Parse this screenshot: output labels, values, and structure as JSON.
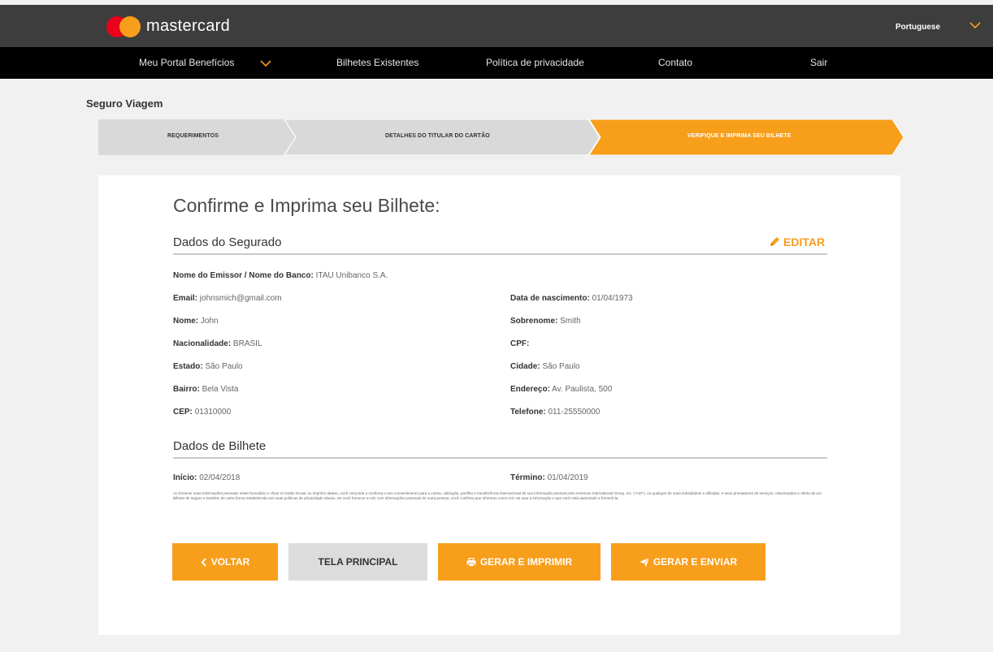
{
  "header": {
    "brand": "mastercard",
    "language": "Portuguese"
  },
  "nav": {
    "items": [
      {
        "label": "Meu Portal Benefícios"
      },
      {
        "label": "Bilhetes Existentes"
      },
      {
        "label": "Política de privacidade"
      },
      {
        "label": "Contato"
      },
      {
        "label": "Sair"
      }
    ]
  },
  "page": {
    "title": "Seguro Viagem"
  },
  "stepper": {
    "steps": [
      {
        "label": "REQUERIMENTOS",
        "active": false
      },
      {
        "label": "DETALHES DO TITULAR DO CARTÃO",
        "active": false
      },
      {
        "label": "VERIFIQUE E IMPRIMA SEU BILHETE",
        "active": true
      }
    ]
  },
  "main": {
    "title": "Confirme e Imprima seu Bilhete:",
    "insured_section": "Dados do Segurado",
    "edit_label": "EDITAR",
    "ticket_section": "Dados de Bilhete",
    "fields": {
      "issuer": {
        "label": "Nome do Emissor / Nome do Banco:",
        "value": "ITAU Unibanco S.A."
      },
      "email": {
        "label": "Email:",
        "value": "johnsmich@gmail.com"
      },
      "birth": {
        "label": "Data de nascimento:",
        "value": "01/04/1973"
      },
      "name": {
        "label": "Nome:",
        "value": "John"
      },
      "surname": {
        "label": "Sobrenome:",
        "value": "Smith"
      },
      "nationality": {
        "label": "Nacionalidade:",
        "value": "BRASIL"
      },
      "cpf": {
        "label": "CPF:",
        "value": ""
      },
      "state": {
        "label": "Estado:",
        "value": "São Paulo"
      },
      "city": {
        "label": "Cidade:",
        "value": "São Paulo"
      },
      "district": {
        "label": "Bairro:",
        "value": "Bela Vista"
      },
      "address": {
        "label": "Endereço:",
        "value": "Av. Paulista, 500"
      },
      "cep": {
        "label": "CEP:",
        "value": "01310000"
      },
      "phone": {
        "label": "Telefone:",
        "value": "011-25550000"
      },
      "start": {
        "label": "Início:",
        "value": "02/04/2018"
      },
      "end": {
        "label": "Término:",
        "value": "01/04/2019"
      }
    },
    "disclaimer": "Ao fornecer suas informações pessoais neste formulário e clicar no botão Enviar ou Imprimir abaixo, você concorda e confirma o seu consentimento para a coleta, utilização, partilha e transferência internacional de sua informação pessoal pelo American International Group, Inc. (\"AIG\"), ou qualquer de suas subsidiárias e afiliadas, e seus prestadores de serviços, relacionados a oferta de um Bilhete de seguro e também de outra forma estabelecida nas suas políticas de privacidade abaixo. Se você fornecer a AIG com informações pessoais de outra pessoa, você confirma que informou como AIG vai usar a informação e que você está autorizado a fornecê-la."
  },
  "buttons": {
    "back": "VOLTAR",
    "home": "TELA PRINCIPAL",
    "print": "GERAR E IMPRIMIR",
    "send": "GERAR E ENVIAR"
  },
  "colors": {
    "accent": "#f79e1b",
    "header_bg": "#3d3d3d",
    "nav_bg": "#000000",
    "step_inactive": "#d9d9d9"
  }
}
